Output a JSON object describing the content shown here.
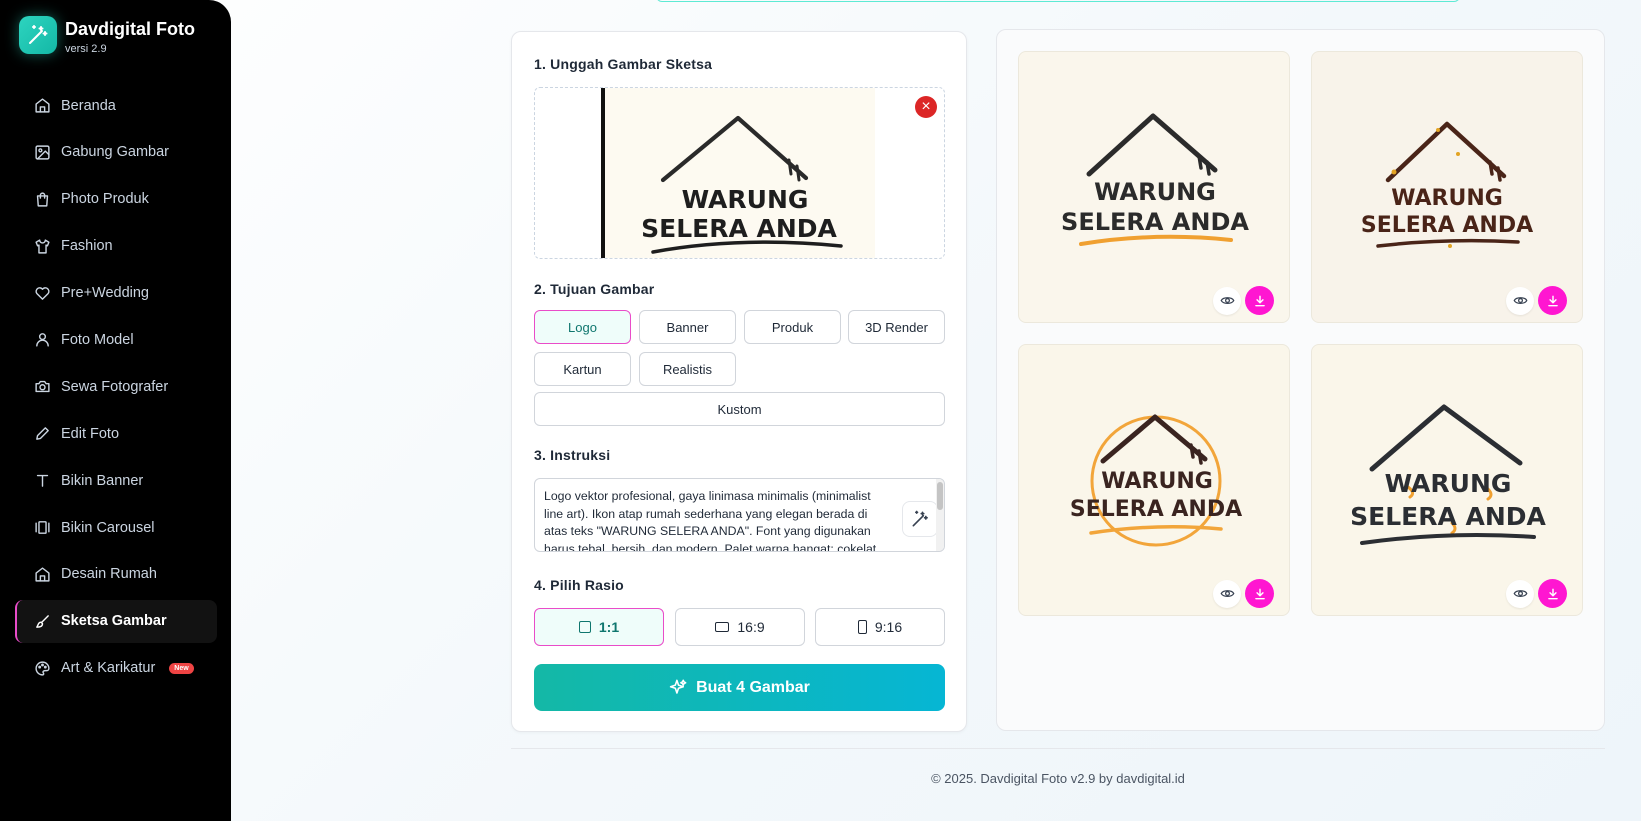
{
  "brand": {
    "title": "Davdigital Foto",
    "version": "versi 2.9"
  },
  "sidebar": {
    "items": [
      {
        "label": "Beranda",
        "icon": "home-icon"
      },
      {
        "label": "Gabung Gambar",
        "icon": "image-icon"
      },
      {
        "label": "Photo Produk",
        "icon": "shopping-bag-icon"
      },
      {
        "label": "Fashion",
        "icon": "shirt-icon"
      },
      {
        "label": "Pre+Wedding",
        "icon": "heart-icon"
      },
      {
        "label": "Foto Model",
        "icon": "user-icon"
      },
      {
        "label": "Sewa Fotografer",
        "icon": "camera-icon"
      },
      {
        "label": "Edit Foto",
        "icon": "pencil-icon"
      },
      {
        "label": "Bikin Banner",
        "icon": "text-icon"
      },
      {
        "label": "Bikin Carousel",
        "icon": "carousel-icon"
      },
      {
        "label": "Desain Rumah",
        "icon": "home-icon"
      },
      {
        "label": "Sketsa Gambar",
        "icon": "brush-icon",
        "active": true
      },
      {
        "label": "Art & Karikatur",
        "icon": "palette-icon",
        "badge": "New"
      }
    ]
  },
  "form": {
    "step1_title": "1. Unggah Gambar Sketsa",
    "sketch_text_line1": "WARUNG",
    "sketch_text_line2": "SELERA ANDA",
    "step2_title": "2. Tujuan Gambar",
    "purposes": [
      "Logo",
      "Banner",
      "Produk",
      "3D Render",
      "Kartun",
      "Realistis",
      "Kustom"
    ],
    "purpose_selected": "Logo",
    "step3_title": "3. Instruksi",
    "instructions": "Logo vektor profesional, gaya linimasa minimalis (minimalist line art). Ikon atap rumah sederhana yang elegan berada di atas teks \"WARUNG SELERA ANDA\". Font yang digunakan harus tebal, bersih, dan modern. Palet warna hangat: cokelat",
    "step4_title": "4. Pilih Rasio",
    "ratios": [
      "1:1",
      "16:9",
      "9:16"
    ],
    "ratio_selected": "1:1",
    "generate_label": "Buat 4 Gambar"
  },
  "results": [
    {
      "line1": "WARUNG",
      "line2": "SELERA ANDA",
      "style": "charcoal-orange-swoosh",
      "colors": {
        "bg": "#faf6ec",
        "ink": "#2b2b2b",
        "accent": "#f0a030"
      }
    },
    {
      "line1": "WARUNG",
      "line2": "SELERA ANDA",
      "style": "brown-gold-dots",
      "colors": {
        "bg": "#f8f3ea",
        "ink": "#4a2418",
        "accent": "#e3a323"
      }
    },
    {
      "line1": "WARUNG",
      "line2": "SELERA ANDA",
      "style": "brown-orange-circle",
      "colors": {
        "bg": "#faf6ea",
        "ink": "#3a2420",
        "accent": "#f2a53a"
      }
    },
    {
      "line1": "WARUNG",
      "line2": "SELERA ANDA",
      "style": "charcoal-orange-splash",
      "colors": {
        "bg": "#faf6ea",
        "ink": "#2b2e33",
        "accent": "#f0a030"
      }
    }
  ],
  "colors": {
    "accent_teal": "#14b8a6",
    "accent_pink": "#ff16d1",
    "sidebar_bg": "#000000"
  },
  "footer": {
    "text": "© 2025. Davdigital Foto v2.9 by davdigital.id"
  }
}
